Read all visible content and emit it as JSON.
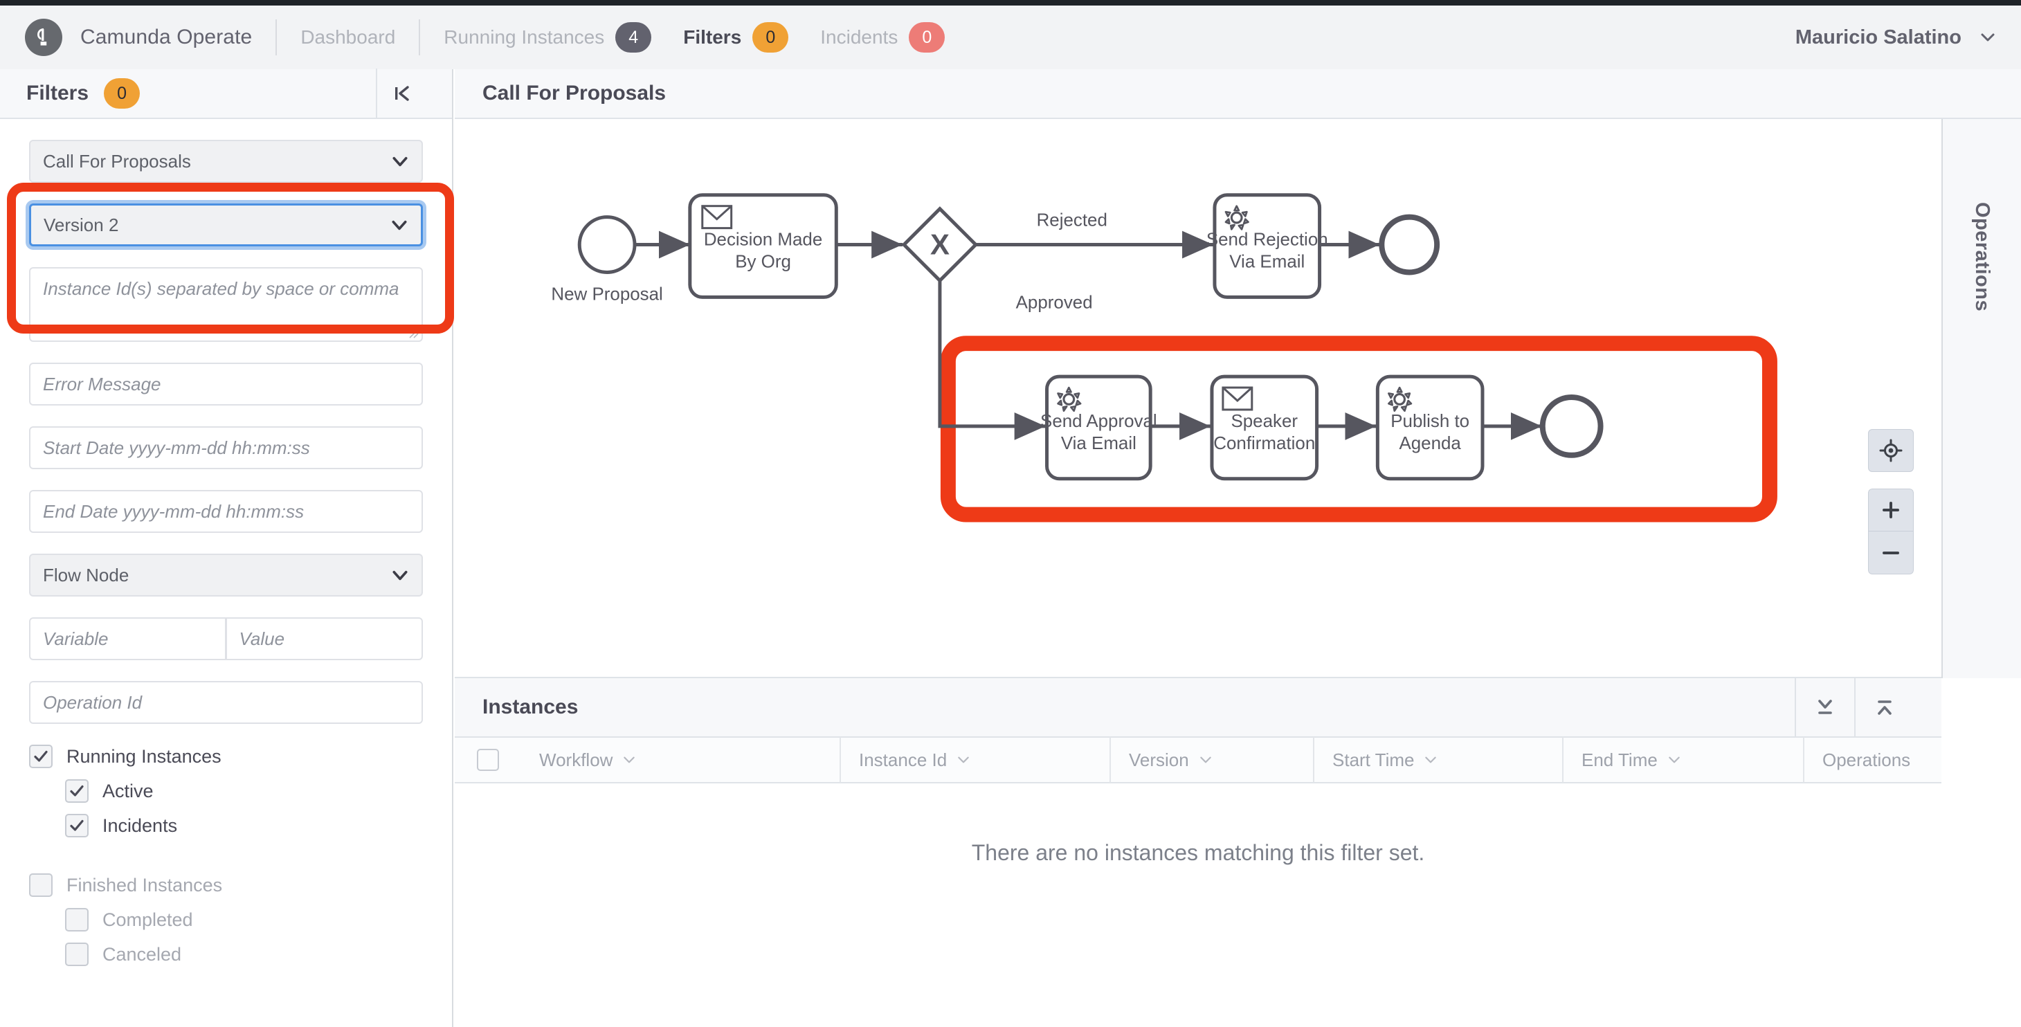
{
  "header": {
    "brand": "Camunda Operate",
    "logo_icon": "camunda-logo-icon",
    "nav": [
      {
        "label": "Dashboard",
        "badge": null,
        "badge_color": null,
        "active": false
      },
      {
        "label": "Running Instances",
        "badge": "4",
        "badge_color": "#62626e",
        "active": false
      },
      {
        "label": "Filters",
        "badge": "0",
        "badge_color": "#f0a135",
        "active": true
      },
      {
        "label": "Incidents",
        "badge": "0",
        "badge_color": "#ed7c77",
        "active": false
      }
    ],
    "user": "Mauricio Salatino",
    "user_caret_icon": "chevron-down-icon"
  },
  "sidebar": {
    "title": "Filters",
    "badge": "0",
    "collapse_icon": "collapse-left-icon",
    "workflow_select": {
      "value": "Call For Proposals",
      "caret_icon": "chevron-down-icon"
    },
    "version_select": {
      "value": "Version 2",
      "caret_icon": "chevron-down-icon",
      "focused": true
    },
    "instance_ids": {
      "placeholder": "Instance Id(s) separated by space or comma",
      "value": ""
    },
    "error_message": {
      "placeholder": "Error Message",
      "value": ""
    },
    "start_date": {
      "placeholder": "Start Date yyyy-mm-dd hh:mm:ss",
      "value": ""
    },
    "end_date": {
      "placeholder": "End Date yyyy-mm-dd hh:mm:ss",
      "value": ""
    },
    "flow_node_select": {
      "value": "Flow Node",
      "caret_icon": "chevron-down-icon"
    },
    "variable": {
      "placeholder": "Variable",
      "value": ""
    },
    "variable_value": {
      "placeholder": "Value",
      "value": ""
    },
    "operation_id": {
      "placeholder": "Operation Id",
      "value": ""
    },
    "checkboxes": [
      {
        "label": "Running Instances",
        "checked": true,
        "indent": false,
        "dim": false
      },
      {
        "label": "Active",
        "checked": true,
        "indent": true,
        "dim": false
      },
      {
        "label": "Incidents",
        "checked": true,
        "indent": true,
        "dim": false
      },
      {
        "label": "Finished Instances",
        "checked": false,
        "indent": false,
        "dim": true
      },
      {
        "label": "Completed",
        "checked": false,
        "indent": true,
        "dim": true
      },
      {
        "label": "Canceled",
        "checked": false,
        "indent": true,
        "dim": true
      }
    ]
  },
  "annotations": {
    "color": "#ee3a17",
    "select_box_label": "highlight-around-workflow-and-version-selects",
    "diagram_box_label": "highlight-around-approved-path-tasks"
  },
  "diagram": {
    "title": "Call For Proposals",
    "nodes": [
      {
        "id": "start",
        "type": "start-event",
        "label": "New Proposal"
      },
      {
        "id": "decision",
        "type": "message-task",
        "label_line1": "Decision Made",
        "label_line2": "By Org",
        "icon": "envelope-icon"
      },
      {
        "id": "gateway",
        "type": "exclusive-gateway",
        "label": "X"
      },
      {
        "id": "rejection",
        "type": "service-task",
        "label_line1": "Send Rejection",
        "label_line2": "Via Email",
        "icon": "gear-icon"
      },
      {
        "id": "end_rejected",
        "type": "end-event",
        "label": ""
      },
      {
        "id": "approval",
        "type": "service-task",
        "label_line1": "Send Approval",
        "label_line2": "Via Email",
        "icon": "gear-icon"
      },
      {
        "id": "speaker",
        "type": "message-task",
        "label_line1": "Speaker",
        "label_line2": "Confirmation",
        "icon": "envelope-icon"
      },
      {
        "id": "publish",
        "type": "service-task",
        "label_line1": "Publish to",
        "label_line2": "Agenda",
        "icon": "gear-icon"
      },
      {
        "id": "end_approved",
        "type": "end-event",
        "label": ""
      }
    ],
    "flow_labels": {
      "rejected": "Rejected",
      "approved": "Approved"
    },
    "controls": {
      "reset_icon": "crosshair-target-icon",
      "zoom_in_label": "+",
      "zoom_out_label": "−"
    }
  },
  "operations_panel": {
    "label": "Operations"
  },
  "instances": {
    "title": "Instances",
    "action_icons": [
      "collapse-down-icon",
      "expand-up-icon"
    ],
    "columns": [
      {
        "label": "Workflow",
        "sortable": true
      },
      {
        "label": "Instance Id",
        "sortable": true
      },
      {
        "label": "Version",
        "sortable": true
      },
      {
        "label": "Start Time",
        "sortable": true
      },
      {
        "label": "End Time",
        "sortable": true
      },
      {
        "label": "Operations",
        "sortable": false
      }
    ],
    "rows": [],
    "empty_message": "There are no instances matching this filter set."
  }
}
